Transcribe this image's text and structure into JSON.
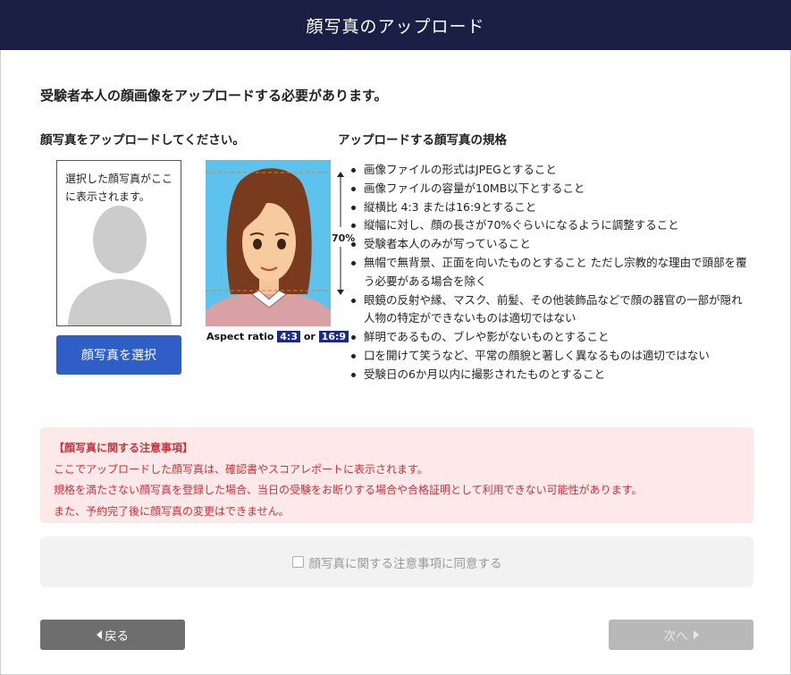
{
  "header": {
    "title": "顔写真のアップロード"
  },
  "lead": "受験者本人の顔画像をアップロードする必要があります。",
  "upload": {
    "heading": "顔写真をアップロードしてください。",
    "preview_text": "選択した顔写真がここに表示されます。",
    "select_button": "顔写真を選択"
  },
  "example": {
    "aspect_label": "Aspect ratio",
    "ratio_a": "4:3",
    "or": "or",
    "ratio_b": "16:9",
    "face_ratio": "70%"
  },
  "spec": {
    "heading": "アップロードする顔写真の規格",
    "rules": [
      "画像ファイルの形式はJPEGとすること",
      "画像ファイルの容量が10MB以下とすること",
      "縦横比 4:3 または16:9とすること",
      "縦幅に対し、顔の長さが70%ぐらいになるように調整すること",
      "受験者本人のみが写っていること",
      "無帽で無背景、正面を向いたものとすること ただし宗教的な理由で頭部を覆う必要がある場合を除く",
      "眼鏡の反射や縁、マスク、前髪、その他装飾品などで顔の器官の一部が隠れ人物の特定ができないものは適切ではない",
      "鮮明であるもの、ブレや影がないものとすること",
      "口を開けて笑うなど、平常の顔貌と著しく異なるものは適切ではない",
      "受験日の6か月以内に撮影されたものとすること"
    ]
  },
  "notice": {
    "title": "【顔写真に関する注意事項】",
    "lines": [
      "ここでアップロードした顔写真は、確認書やスコアレポートに表示されます。",
      "規格を満たさない顔写真を登録した場合、当日の受験をお断りする場合や合格証明として利用できない可能性があります。",
      "また、予約完了後に顔写真の変更はできません。"
    ]
  },
  "agree": {
    "label": "顔写真に関する注意事項に同意する",
    "checked": false
  },
  "nav": {
    "back": "戻る",
    "next": "次へ"
  },
  "colors": {
    "header_bg": "#1a1f45",
    "primary": "#2f5fc6",
    "notice_bg": "#fde9ea",
    "notice_text": "#c8323a"
  }
}
